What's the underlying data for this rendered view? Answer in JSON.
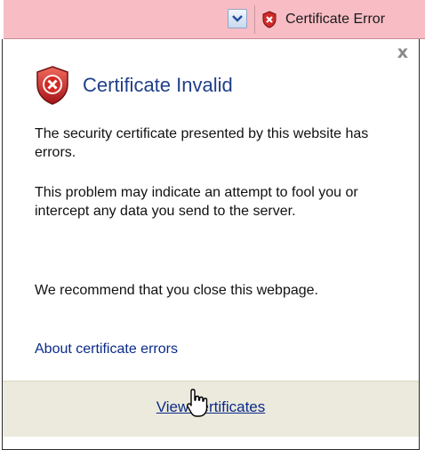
{
  "address_bar": {
    "dropdown_icon": "chevron-down-icon",
    "cert_error_label": "Certificate Error",
    "cert_error_icon": "shield-x-icon",
    "background_color": "#f7bcc4"
  },
  "popup": {
    "title": "Certificate Invalid",
    "title_icon": "shield-error-icon",
    "close_icon": "close-icon",
    "close_glyph": "x",
    "paragraph_1": "The security certificate presented by this website has errors.",
    "paragraph_2": "This problem may indicate an attempt to fool you or intercept any data you send to the server.",
    "paragraph_3": "We recommend that you close this webpage.",
    "about_link": "About certificate errors",
    "view_certificates": "View certificates",
    "accent_color": "#1f3f8a",
    "link_color": "#0a2a8a",
    "footer_color": "#eceadc"
  },
  "cursor": {
    "icon": "hand-pointer-icon"
  }
}
